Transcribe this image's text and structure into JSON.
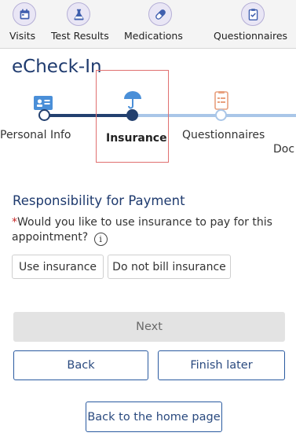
{
  "nav": {
    "items": [
      {
        "label": "Visits",
        "icon": "calendar-icon"
      },
      {
        "label": "Test Results",
        "icon": "flask-icon"
      },
      {
        "label": "Medications",
        "icon": "pill-icon"
      },
      {
        "label": "Questionnaires",
        "icon": "checklist-icon"
      }
    ]
  },
  "page_title": "eCheck-In",
  "steps": [
    {
      "label": "Personal Info",
      "state": "complete"
    },
    {
      "label": "Insurance",
      "state": "current"
    },
    {
      "label": "Questionnaires",
      "state": "pending"
    },
    {
      "label": "Doc",
      "state": "pending"
    }
  ],
  "section_title": "Responsibility for Payment",
  "question": {
    "required_mark": "*",
    "text": "Would you like to use insurance to pay for this appointment?",
    "info_icon": "i"
  },
  "choices": {
    "use_insurance": "Use insurance",
    "do_not_bill": "Do not bill insurance"
  },
  "buttons": {
    "next": "Next",
    "back": "Back",
    "finish_later": "Finish later",
    "home": "Back to the home page"
  },
  "colors": {
    "accent": "#1e3a6e",
    "track_done": "#23406f",
    "track_pending": "#a9c6e8",
    "highlight": "#e07070"
  }
}
